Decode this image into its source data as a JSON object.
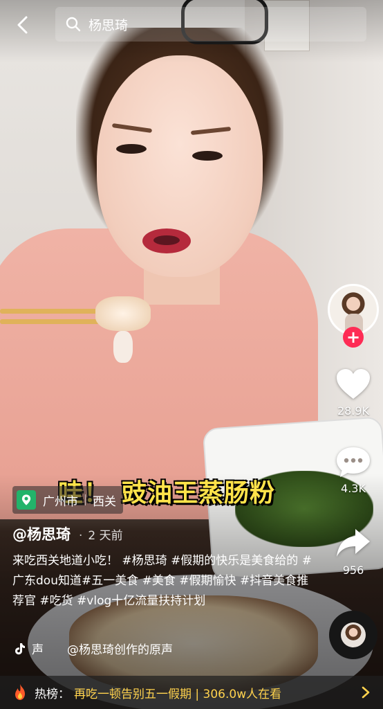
{
  "search": {
    "query": "杨思琦"
  },
  "banner": {
    "exclaim": "哇！",
    "title": "豉油王蒸肠粉"
  },
  "rail": {
    "likes": "28.9K",
    "comments": "4.3K",
    "shares": "956",
    "follow_symbol": "+"
  },
  "location": {
    "city": "广州市",
    "district": "西关"
  },
  "post": {
    "author": "@杨思琦",
    "time": "2 天前",
    "caption_text": "来吃西关地道小吃！",
    "tags": [
      "#杨思琦",
      "#假期的快乐是美食给的",
      "#广东dou知道",
      "#五一美食",
      "#美食",
      "#假期愉快",
      "#抖音美食推荐官",
      "#吃货",
      "#vlog十亿流量扶持计划"
    ]
  },
  "music": {
    "label": "声",
    "text": "@杨思琦创作的原声"
  },
  "hotbar": {
    "label": "热榜：",
    "text": "再吃一顿告别五一假期 | 306.0w人在看"
  },
  "icons": {
    "back": "back-arrow-icon",
    "search": "search-icon",
    "like": "heart-icon",
    "comment": "comment-bubble-icon",
    "share": "share-arrow-icon",
    "location": "location-pin-icon",
    "music": "tiktok-note-icon",
    "hot": "fire-icon",
    "chevron": "chevron-right-icon"
  },
  "colors": {
    "accent_red": "#fe2c55",
    "location_green": "#22b36a",
    "banner_yellow": "#ffe34a",
    "hot_yellow": "#ffd24d"
  }
}
